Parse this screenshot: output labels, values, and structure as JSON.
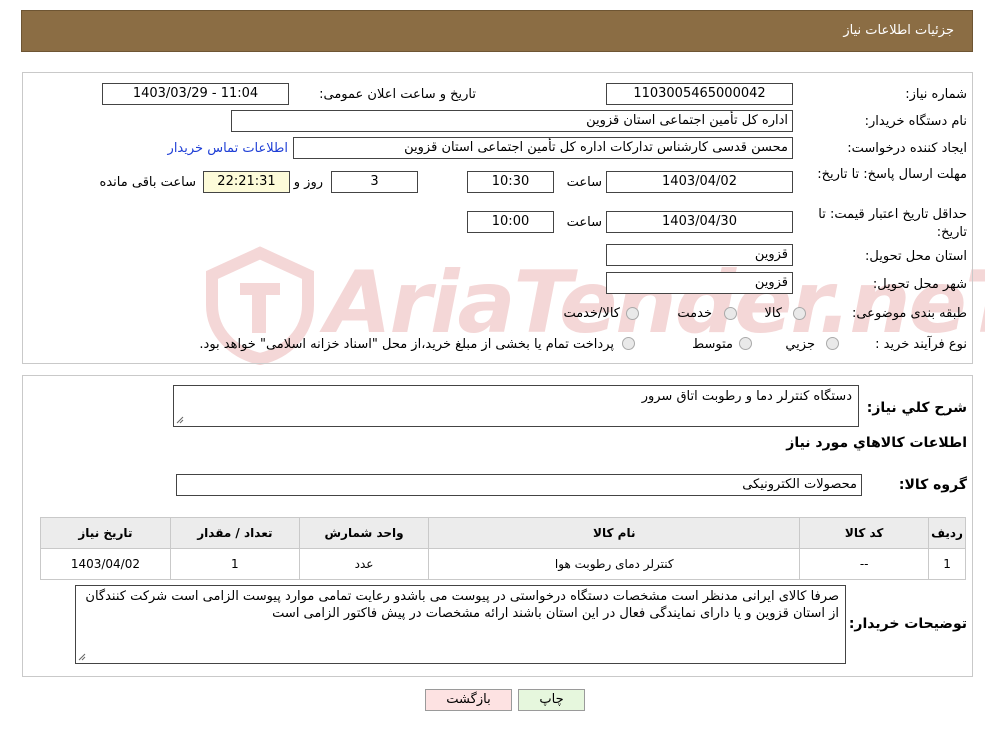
{
  "header": {
    "title": "جزئیات اطلاعات نیاز"
  },
  "form": {
    "need_number_label": "شماره نیاز:",
    "need_number": "1103005465000042",
    "announce_label": "تاریخ و ساعت اعلان عمومی:",
    "announce_value": "1403/03/29 - 11:04",
    "buyer_org_label": "نام دستگاه خریدار:",
    "buyer_org": "اداره کل تأمین اجتماعی استان قزوین",
    "creator_label": "ایجاد کننده درخواست:",
    "creator": "محسن قدسی کارشناس تدارکات اداره کل تأمین اجتماعی استان قزوین",
    "contact_link": "اطلاعات تماس خریدار",
    "deadline_label": "مهلت ارسال پاسخ: تا تاریخ:",
    "deadline_date": "1403/04/02",
    "time_label": "ساعت",
    "deadline_time": "10:30",
    "days_value": "3",
    "days_label": "روز و",
    "remaining_time": "22:21:31",
    "remaining_label": "ساعت باقی مانده",
    "validity_label": "حداقل تاریخ اعتبار قیمت: تا تاریخ:",
    "validity_date": "1403/04/30",
    "validity_time": "10:00",
    "province_label": "استان محل تحویل:",
    "province": "قزوین",
    "city_label": "شهر محل تحویل:",
    "city": "قزوین",
    "category_label": "طبقه بندی موضوعی:",
    "category_options": [
      "کالا",
      "خدمت",
      "کالا/خدمت"
    ],
    "process_label": "نوع فرآیند خرید :",
    "process_options": [
      "جزیي",
      "متوسط"
    ],
    "process_note": "پرداخت تمام یا بخشی از مبلغ خرید،از محل \"اسناد خزانه اسلامی\" خواهد بود."
  },
  "watermark": "AriaTender.neT",
  "summary": {
    "description_label": "شرح کلي نياز:",
    "description": "دستگاه کنترلر دما و رطوبت اتاق سرور",
    "items_title": "اطلاعات کالاهاي مورد نياز",
    "group_label": "گروه کالا:",
    "group": "محصولات الکترونیکی"
  },
  "table": {
    "headers": [
      "ردیف",
      "کد کالا",
      "نام کالا",
      "واحد شمارش",
      "تعداد / مقدار",
      "تاریخ نیاز"
    ],
    "rows": [
      [
        "1",
        "--",
        "کنترلر دمای رطوبت هوا",
        "عدد",
        "1",
        "1403/04/02"
      ]
    ]
  },
  "buyer_notes": {
    "label": "توضیحات خریدار:",
    "text": "صرفا کالای ایرانی مدنظر است مشخصات دستگاه درخواستی در پیوست می باشدو رعایت تمامی موارد پیوست الزامی است شرکت کنندگان از استان قزوین و یا دارای نمایندگی فعال در این استان باشند ارائه مشخصات در پیش فاکتور الزامی است"
  },
  "buttons": {
    "print": "چاپ",
    "back": "بازگشت"
  },
  "colors": {
    "header_bg": "#8b6d44",
    "back_button_bg": "#fde2e2",
    "print_button_bg": "#e6f7dd",
    "link": "#1f3fd6"
  }
}
